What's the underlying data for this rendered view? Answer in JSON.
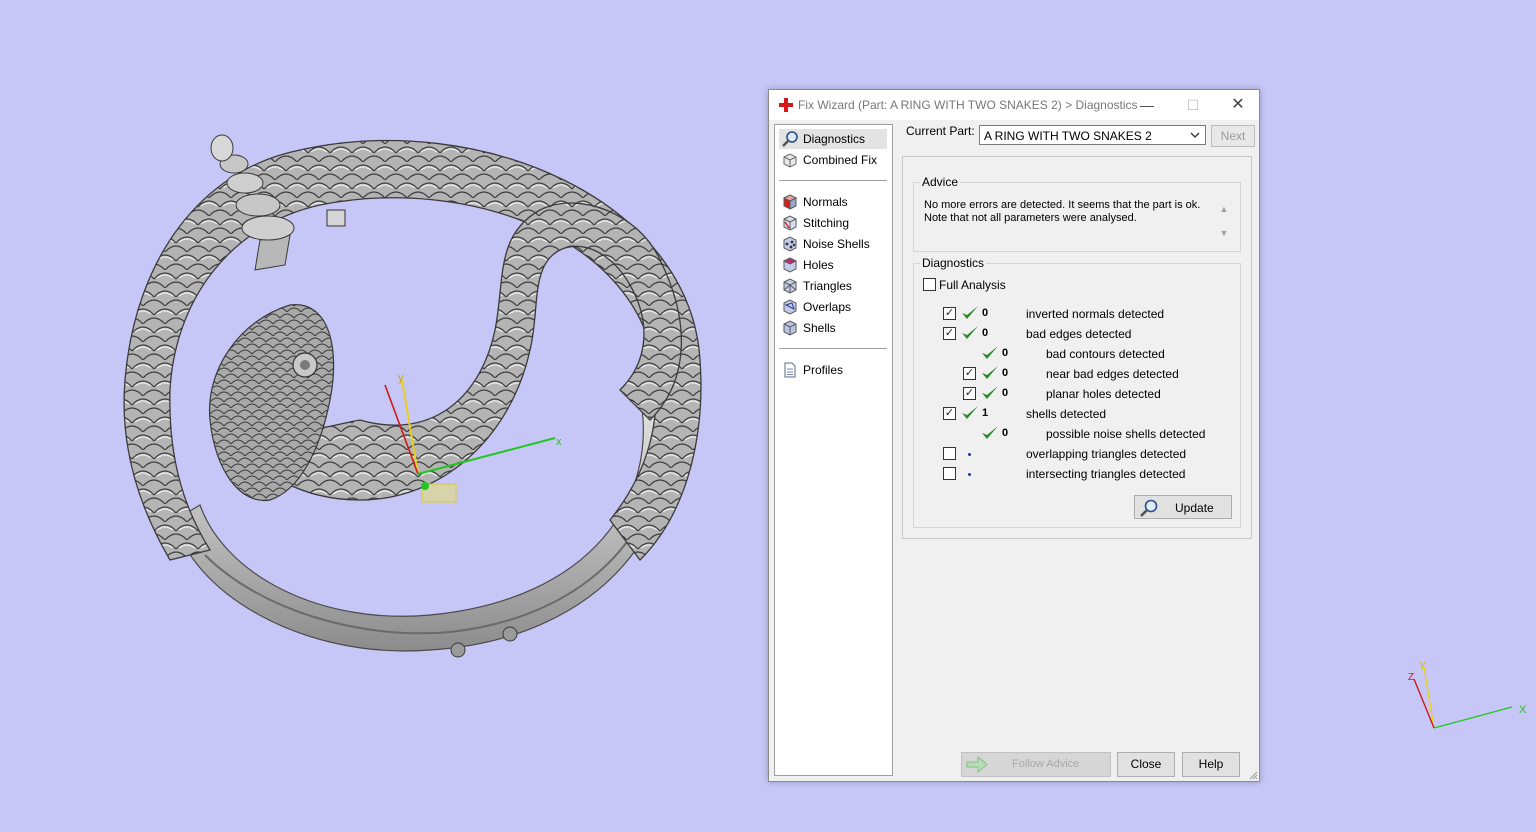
{
  "viewport": {
    "axes": {
      "x": "x",
      "y": "y"
    }
  },
  "mini_axes": {
    "x": "X",
    "y": "Y",
    "z": "Z"
  },
  "dialog": {
    "title": "Fix Wizard (Part: A RING WITH TWO SNAKES 2) > Diagnostics",
    "window_buttons": {
      "minimize": "—",
      "maximize": "☐",
      "close": "✕"
    },
    "nav": {
      "top": [
        {
          "label": "Diagnostics",
          "icon": "magnifier-icon",
          "selected": true
        },
        {
          "label": "Combined Fix",
          "icon": "cube-stack-icon"
        }
      ],
      "tools": [
        {
          "label": "Normals",
          "icon": "normals-cube-icon"
        },
        {
          "label": "Stitching",
          "icon": "stitching-cube-icon"
        },
        {
          "label": "Noise Shells",
          "icon": "noise-shells-icon"
        },
        {
          "label": "Holes",
          "icon": "holes-cube-icon"
        },
        {
          "label": "Triangles",
          "icon": "triangles-cube-icon"
        },
        {
          "label": "Overlaps",
          "icon": "overlaps-cube-icon"
        },
        {
          "label": "Shells",
          "icon": "shells-cube-icon"
        }
      ],
      "bottom": [
        {
          "label": "Profiles",
          "icon": "document-icon"
        }
      ]
    },
    "current_part": {
      "label": "Current Part:",
      "value": "A RING WITH TWO SNAKES 2"
    },
    "next_label": "Next",
    "advice": {
      "title": "Advice",
      "line1": "No more errors are detected. It seems that the part is ok.",
      "line2": "Note that not all parameters were analysed."
    },
    "diagnostics": {
      "title": "Diagnostics",
      "full_analysis_label": "Full Analysis",
      "full_analysis_checked": false,
      "rows": [
        {
          "checkbox": "checked",
          "status": "ok",
          "count": "0",
          "label": "inverted normals detected",
          "indent": 0
        },
        {
          "checkbox": "checked",
          "status": "ok",
          "count": "0",
          "label": "bad edges detected",
          "indent": 0
        },
        {
          "checkbox": "none",
          "status": "ok",
          "count": "0",
          "label": "bad contours detected",
          "indent": 1
        },
        {
          "checkbox": "checked",
          "status": "ok",
          "count": "0",
          "label": "near bad edges detected",
          "indent": 1
        },
        {
          "checkbox": "checked",
          "status": "ok",
          "count": "0",
          "label": "planar holes detected",
          "indent": 1
        },
        {
          "checkbox": "checked",
          "status": "ok",
          "count": "1",
          "label": "shells detected",
          "indent": 0
        },
        {
          "checkbox": "none",
          "status": "ok",
          "count": "0",
          "label": "possible noise shells detected",
          "indent": 1
        },
        {
          "checkbox": "unchecked",
          "status": "pending",
          "count": "",
          "label": "overlapping triangles detected",
          "indent": 0
        },
        {
          "checkbox": "unchecked",
          "status": "pending",
          "count": "",
          "label": "intersecting triangles detected",
          "indent": 0
        }
      ],
      "update_label": "Update"
    },
    "buttons": {
      "follow_advice": "Follow Advice",
      "close": "Close",
      "help": "Help"
    }
  },
  "colors": {
    "background": "#c7c7f7",
    "check_green": "#2a8a2a",
    "axis_x": "#22c622",
    "axis_y": "#e8d020",
    "axis_z": "#d01818"
  }
}
